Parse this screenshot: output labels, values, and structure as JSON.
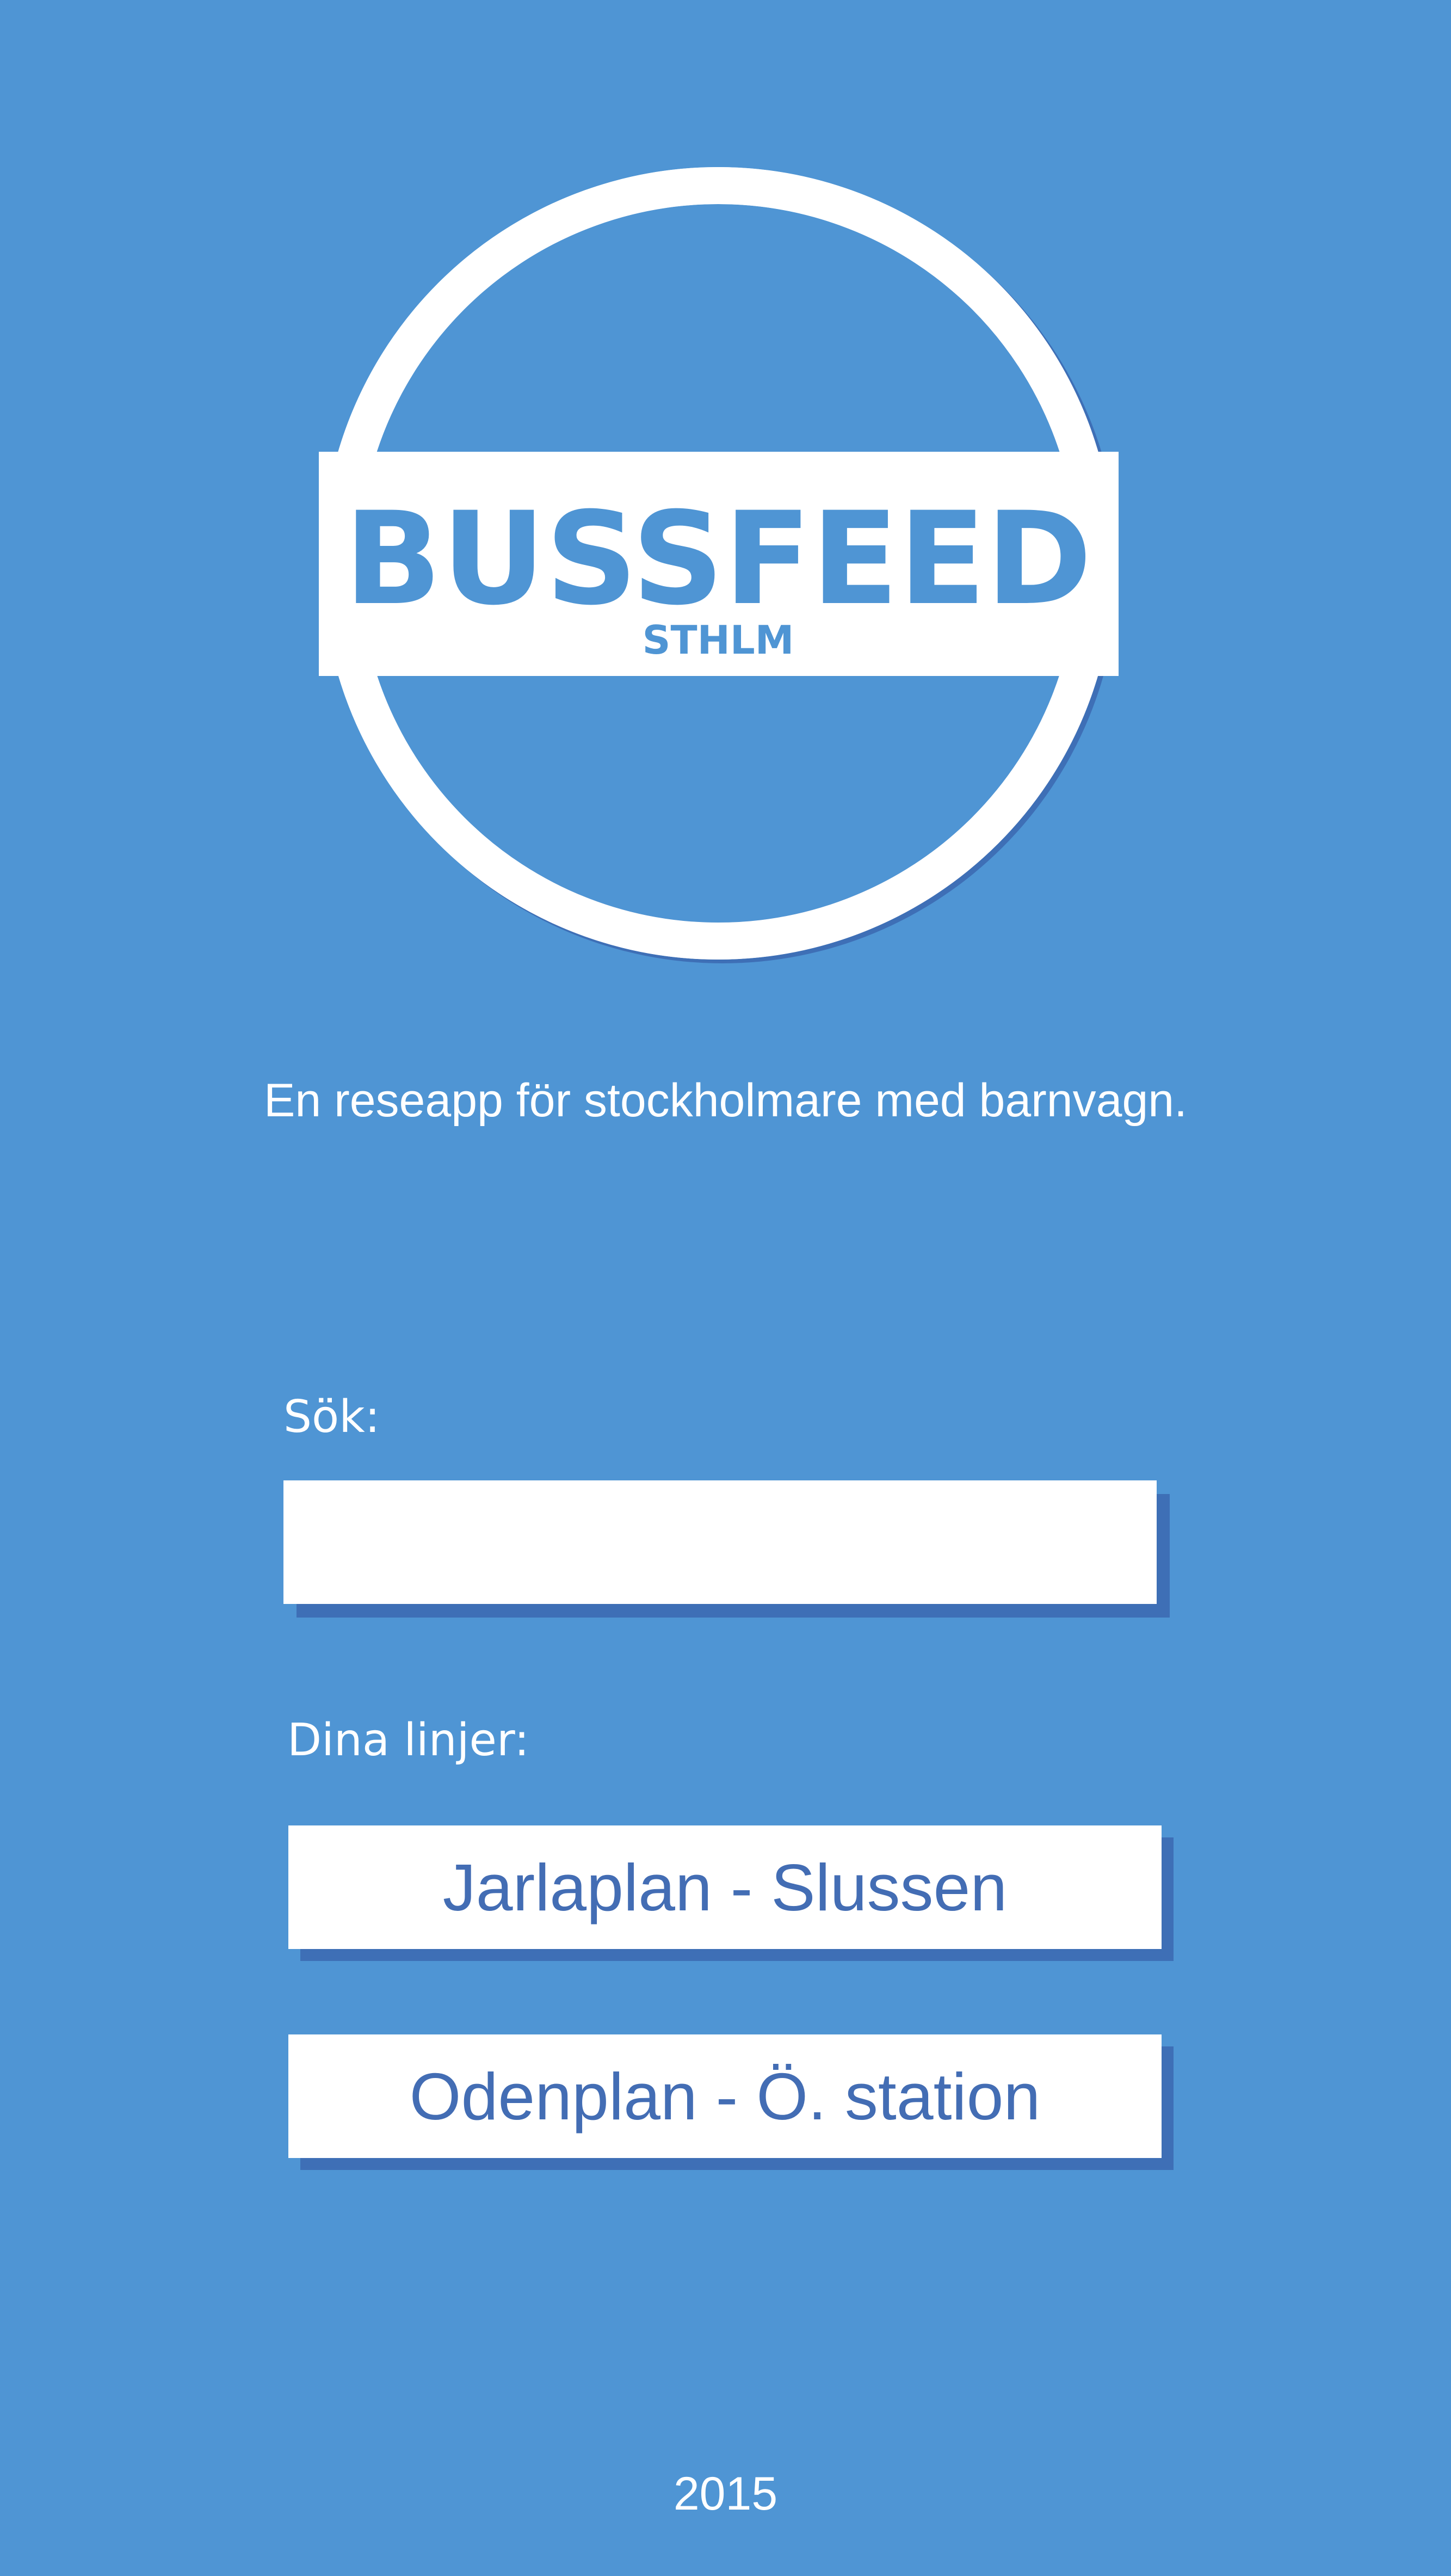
{
  "logo": {
    "name": "BUSSFEED",
    "subname": "STHLM"
  },
  "tagline": "En reseapp för stockholmare med barnvagn.",
  "search": {
    "label": "Sök:",
    "value": "",
    "placeholder": ""
  },
  "lines": {
    "label": "Dina linjer:",
    "items": [
      {
        "label": "Jarlaplan - Slussen"
      },
      {
        "label": "Odenplan - Ö. station"
      }
    ]
  },
  "footer": {
    "year": "2015"
  },
  "colors": {
    "background": "#4f95d4",
    "accent": "#436db4",
    "shadow": "#3e6fb6",
    "surface": "#ffffff"
  }
}
